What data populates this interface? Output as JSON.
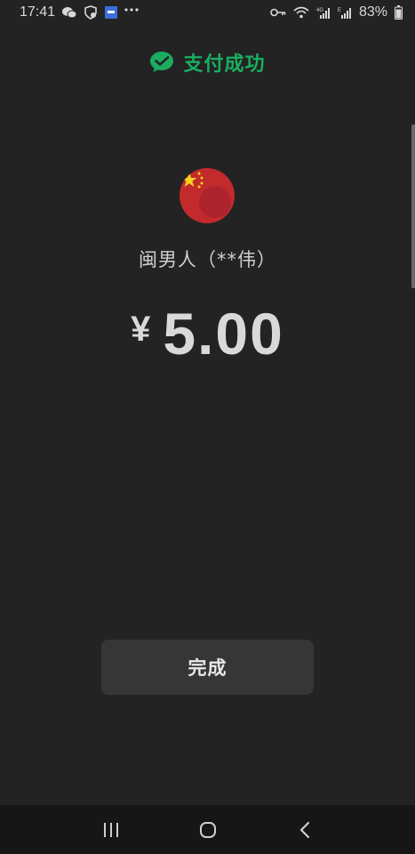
{
  "status_bar": {
    "time": "17:41",
    "battery_percent": "83%",
    "network_label_1": "4G",
    "network_label_2": "E",
    "icons": [
      "wechat-icon",
      "shield-heart-icon",
      "app-notification-icon",
      "more-dots-icon",
      "key-icon",
      "wifi-icon",
      "signal-4g-icon",
      "signal-e-icon",
      "battery-icon"
    ]
  },
  "header": {
    "title": "支付成功",
    "accent_color": "#1aad5f"
  },
  "payment": {
    "merchant": "闽男人（**伟）",
    "currency_symbol": "¥",
    "amount": "5.00"
  },
  "actions": {
    "done_label": "完成"
  },
  "navbar": {
    "icons": [
      "recent-apps-icon",
      "home-icon",
      "back-icon"
    ]
  }
}
